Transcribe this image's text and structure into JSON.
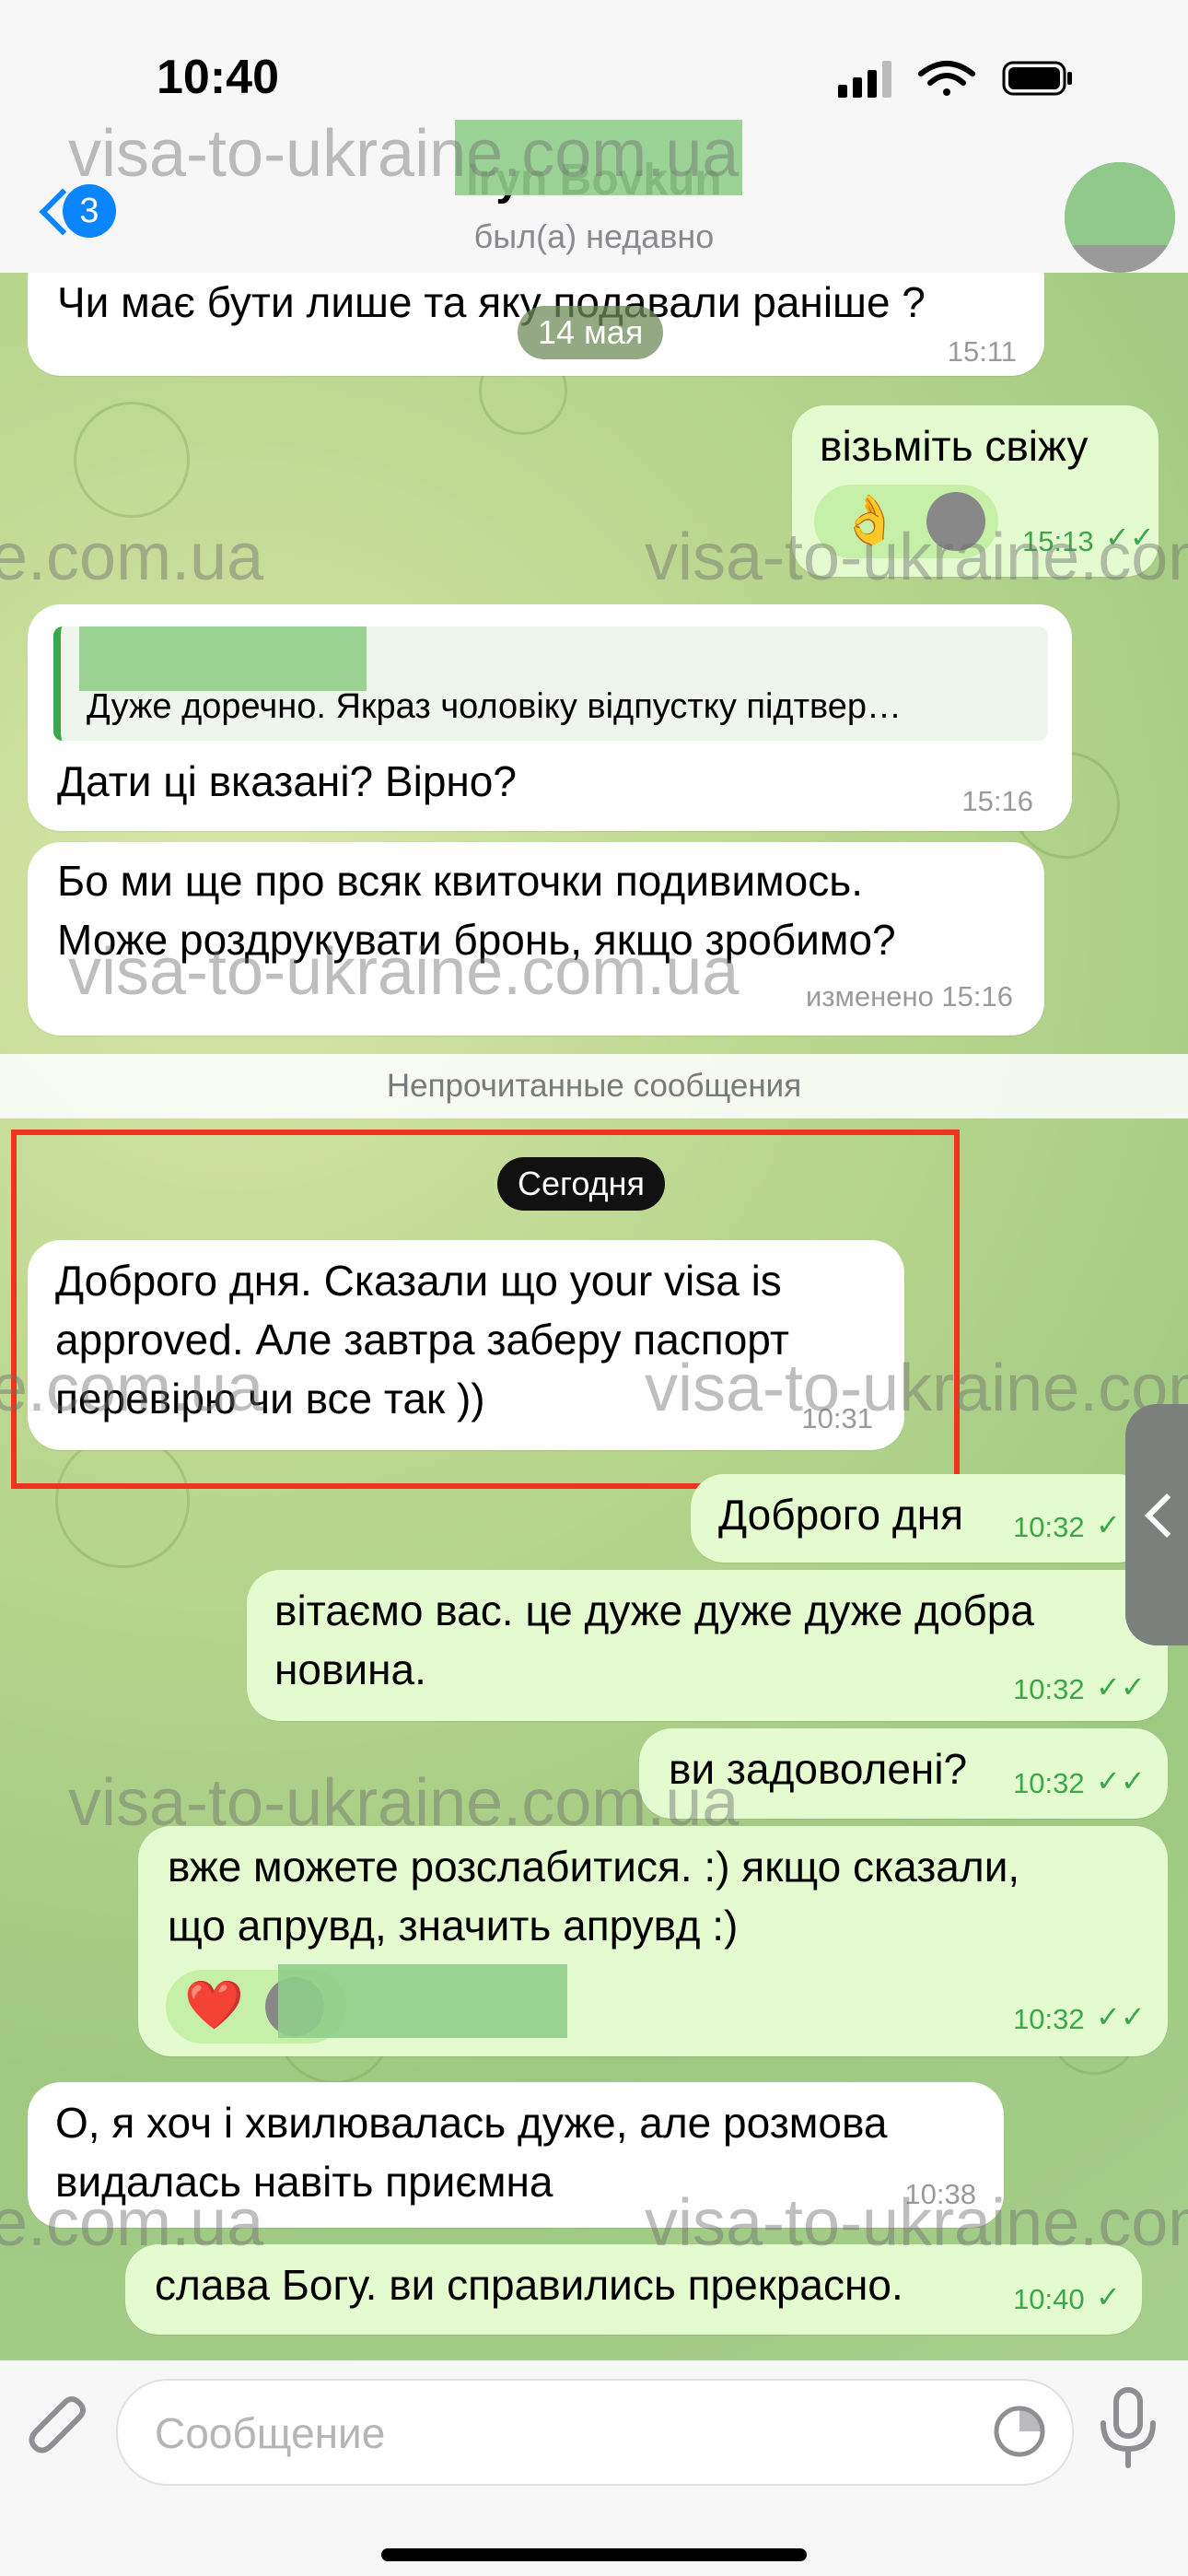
{
  "status": {
    "time": "10:40"
  },
  "header": {
    "unread_count": "3",
    "chat_name": "Iryn Bovkun",
    "last_seen": "был(а) недавно"
  },
  "watermark_text": "visa-to-ukraine.com.ua",
  "watermark_partial": "e.com.ua",
  "date_pill_1": "14 мая",
  "date_pill_2": "Сегодня",
  "unread_divider": "Непрочитанные сообщения",
  "messages": [
    {
      "dir": "in",
      "text": "Чи має бути лише та яку подавали раніше ?",
      "time": "15:11"
    },
    {
      "dir": "out",
      "text": "візьміть свіжу",
      "time": "15:13",
      "reaction": "👌"
    },
    {
      "dir": "in",
      "quote": "Дуже доречно. Якраз чоловіку відпустку підтвер…",
      "text": "Дати ці вказані? Вірно?",
      "time": "15:16"
    },
    {
      "dir": "in",
      "text_lines": [
        "Бо ми ще про всяк квиточки подивимось.",
        "Може роздрукувати бронь, якщо зробимо?"
      ],
      "time": "изменено 15:16"
    },
    {
      "dir": "in",
      "text_lines": [
        "Доброго дня. Сказали що your visa is",
        "approved. Але завтра заберу паспорт",
        "перевірю чи все так ))"
      ],
      "time": "10:31"
    },
    {
      "dir": "out",
      "text": "Доброго дня",
      "time": "10:32"
    },
    {
      "dir": "out",
      "text_lines": [
        "вітаємо вас. це дуже дуже дуже добра",
        "новина."
      ],
      "time": "10:32"
    },
    {
      "dir": "out",
      "text": "ви задоволені?",
      "time": "10:32"
    },
    {
      "dir": "out",
      "text_lines": [
        "вже можете розслабитися. :) якщо сказали,",
        "що апрувд, значить апрувд :)"
      ],
      "time": "10:32",
      "reaction": "❤️"
    },
    {
      "dir": "in",
      "text_lines": [
        "О, я хоч і хвилювалась дуже, але розмова",
        "видалась навіть приємна"
      ],
      "time": "10:38"
    },
    {
      "dir": "out",
      "text": "слава Богу. ви справились прекрасно.",
      "time": "10:40"
    }
  ],
  "composer": {
    "placeholder": "Сообщение"
  },
  "colors": {
    "accent": "#0a84ff",
    "outgoing_bubble": "#e4fbcf",
    "incoming_bubble": "#ffffff",
    "highlight": "#f0321e",
    "read_check": "#3aa84a"
  },
  "icons": [
    "back-chevron-icon",
    "attach-paperclip-icon",
    "sticker-icon",
    "microphone-icon",
    "read-check-icon"
  ]
}
